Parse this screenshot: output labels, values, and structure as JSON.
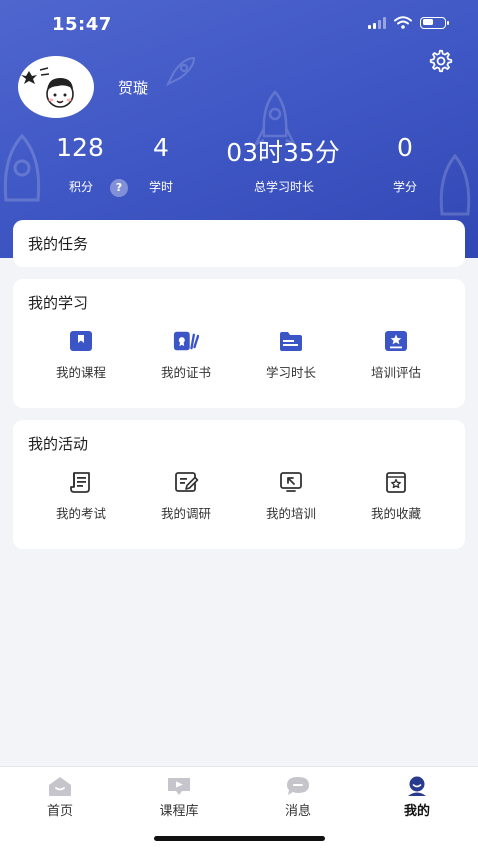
{
  "status_bar": {
    "time": "15:47"
  },
  "profile": {
    "name": "贺璇"
  },
  "stats": [
    {
      "value": "128",
      "label": "积分"
    },
    {
      "value": "4",
      "label": "学时"
    },
    {
      "value": "03时35分",
      "label": "总学习时长"
    },
    {
      "value": "0",
      "label": "学分"
    }
  ],
  "help_badge": "?",
  "tasks": {
    "title": "我的任务"
  },
  "study": {
    "title": "我的学习",
    "items": [
      {
        "label": "我的课程",
        "icon": "course-icon"
      },
      {
        "label": "我的证书",
        "icon": "certificate-icon"
      },
      {
        "label": "学习时长",
        "icon": "folder-icon"
      },
      {
        "label": "培训评估",
        "icon": "evaluation-icon"
      }
    ]
  },
  "activity": {
    "title": "我的活动",
    "items": [
      {
        "label": "我的考试",
        "icon": "exam-icon"
      },
      {
        "label": "我的调研",
        "icon": "survey-icon"
      },
      {
        "label": "我的培训",
        "icon": "training-icon"
      },
      {
        "label": "我的收藏",
        "icon": "favorites-icon"
      }
    ]
  },
  "tabbar": {
    "active_index": 3,
    "items": [
      {
        "label": "首页",
        "icon": "home-icon"
      },
      {
        "label": "课程库",
        "icon": "course-library-icon"
      },
      {
        "label": "消息",
        "icon": "message-icon"
      },
      {
        "label": "我的",
        "icon": "profile-icon"
      }
    ]
  },
  "colors": {
    "header_gradient_start": "#4f66cf",
    "header_gradient_end": "#3147b4",
    "accent_blue": "#3b55c6",
    "tab_active": "#2a3a8f",
    "tab_inactive": "#c5c5cb"
  }
}
